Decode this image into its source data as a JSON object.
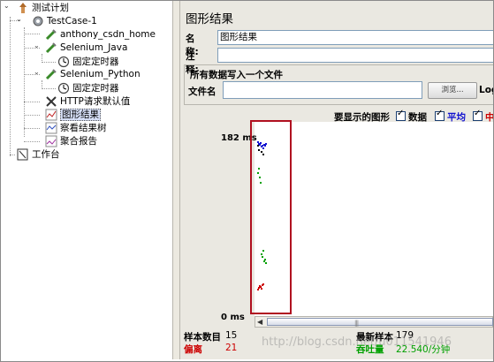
{
  "tree": {
    "items": [
      {
        "label": "测试计划",
        "icon": "test-plan-icon"
      },
      {
        "label": "TestCase-1",
        "icon": "thread-group-icon"
      },
      {
        "label": "anthony_csdn_home",
        "icon": "http-sampler-icon"
      },
      {
        "label": "Selenium_Java",
        "icon": "http-sampler-icon"
      },
      {
        "label": "固定定时器",
        "icon": "timer-icon"
      },
      {
        "label": "Selenium_Python",
        "icon": "http-sampler-icon"
      },
      {
        "label": "固定定时器",
        "icon": "timer-icon"
      },
      {
        "label": "HTTP请求默认值",
        "icon": "config-icon"
      },
      {
        "label": "图形结果",
        "icon": "graph-results-icon"
      },
      {
        "label": "察看结果树",
        "icon": "results-tree-icon"
      },
      {
        "label": "聚合报告",
        "icon": "report-icon"
      },
      {
        "label": "工作台",
        "icon": "workbench-icon"
      }
    ]
  },
  "panel": {
    "title": "图形结果",
    "name_label": "名称:",
    "name_value": "图形结果",
    "note_label": "注释:",
    "file_section": "所有数据写入一个文件",
    "file_label": "文件名",
    "browse_label": "浏览...",
    "log_label": "Log",
    "show_label": "要显示的图形",
    "graph_options": [
      {
        "label": "数据",
        "color": "#000000",
        "checked": true
      },
      {
        "label": "平均",
        "color": "#1010d0",
        "checked": true
      },
      {
        "label": "中",
        "color": "#cc0000",
        "checked": true
      }
    ]
  },
  "chart_data": {
    "type": "scatter",
    "y_top_label": "182 ms",
    "y_bottom_label": "0 ms",
    "ylim": [
      0,
      182
    ],
    "series": [
      {
        "name": "数据",
        "color": "#000000",
        "points": [
          [
            1,
            174
          ],
          [
            2,
            170
          ],
          [
            3,
            176
          ],
          [
            5,
            168
          ],
          [
            7,
            165
          ]
        ]
      },
      {
        "name": "平均",
        "color": "#1010d0",
        "points": [
          [
            1,
            178
          ],
          [
            2,
            176
          ],
          [
            3,
            175
          ],
          [
            4,
            177
          ],
          [
            5,
            173
          ],
          [
            6,
            174
          ],
          [
            7,
            172
          ],
          [
            8,
            175
          ],
          [
            9,
            174
          ],
          [
            10,
            176
          ]
        ]
      },
      {
        "name": "偏离",
        "color": "#cc0000",
        "points": [
          [
            1,
            20
          ],
          [
            2,
            22
          ],
          [
            3,
            24
          ],
          [
            4,
            23
          ],
          [
            5,
            21
          ],
          [
            6,
            25
          ],
          [
            7,
            26
          ]
        ]
      },
      {
        "name": "吞吐量",
        "color": "#00a000",
        "points": [
          [
            1,
            145
          ],
          [
            2,
            150
          ],
          [
            3,
            140
          ],
          [
            4,
            135
          ],
          [
            5,
            58
          ],
          [
            6,
            55
          ],
          [
            7,
            62
          ],
          [
            8,
            50
          ],
          [
            9,
            52
          ],
          [
            10,
            48
          ]
        ]
      }
    ]
  },
  "stats": {
    "samples_label": "样本数目",
    "samples_value": "15",
    "deviation_label": "偏离",
    "deviation_value": "21",
    "latest_label": "最新样本",
    "latest_value": "179",
    "throughput_label": "吞吐量",
    "throughput_value": "22.540/分钟"
  },
  "watermark": "http://blog.csdn.net/u011541946",
  "colors": {
    "panel_bg": "#eae8e1",
    "highlight_box": "#b01020",
    "deviation": "#cc0000",
    "throughput": "#00a000"
  }
}
